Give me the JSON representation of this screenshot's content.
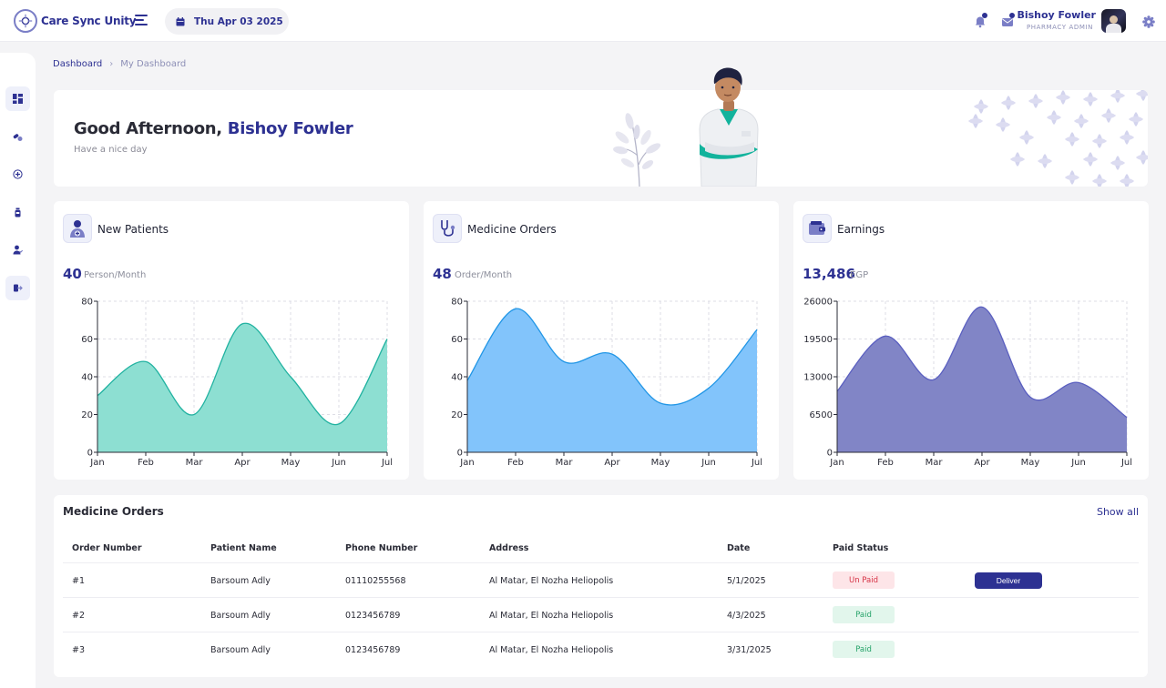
{
  "app": {
    "brand": "Care Sync Unity",
    "date": "Thu Apr 03 2025"
  },
  "user": {
    "name": "Bishoy Fowler",
    "role": "PHARMACY ADMIN"
  },
  "breadcrumb": {
    "home": "Dashboard",
    "separator": "›",
    "current": "My Dashboard"
  },
  "welcome": {
    "greeting": "Good Afternoon,",
    "name": "Bishoy Fowler",
    "subtitle": "Have a nice day"
  },
  "icons": {
    "sidebar": [
      "dashboard-icon",
      "pills-icon",
      "plus-circle-icon",
      "bottle-icon",
      "user-icon",
      "logout-icon"
    ],
    "top": [
      "bell-icon",
      "mail-icon",
      "gear-icon"
    ]
  },
  "colors": {
    "brand": "#2d3192",
    "patients": "#20b2a0",
    "orders": "#2196e6",
    "earnings": "#5a5fc0",
    "unpaid_bg": "#fde5e8",
    "unpaid_text": "#d63345",
    "paid_bg": "#e2f6ec",
    "paid_text": "#27a36a"
  },
  "cards": [
    {
      "title": "New Patients",
      "value": "40",
      "unit": "Person/Month"
    },
    {
      "title": "Medicine Orders",
      "value": "48",
      "unit": "Order/Month"
    },
    {
      "title": "Earnings",
      "value": "13,486",
      "unit": "EGP"
    }
  ],
  "chart_data": [
    {
      "type": "area",
      "categories": [
        "Jan",
        "Feb",
        "Mar",
        "Apr",
        "May",
        "Jun",
        "Jul"
      ],
      "values": [
        30,
        48,
        20,
        68,
        40,
        15,
        60
      ],
      "ylim": [
        0,
        80
      ],
      "yticks": [
        0,
        20,
        40,
        60,
        80
      ],
      "grid": true
    },
    {
      "type": "area",
      "categories": [
        "Jan",
        "Feb",
        "Mar",
        "Apr",
        "May",
        "Jun",
        "Jul"
      ],
      "values": [
        38,
        76,
        48,
        52,
        26,
        34,
        65
      ],
      "ylim": [
        0,
        80
      ],
      "yticks": [
        0,
        20,
        40,
        60,
        80
      ],
      "grid": true
    },
    {
      "type": "area",
      "categories": [
        "Jan",
        "Feb",
        "Mar",
        "Apr",
        "May",
        "Jun",
        "Jul"
      ],
      "values": [
        10500,
        20000,
        12500,
        25000,
        9500,
        12000,
        6000
      ],
      "ylim": [
        0,
        26000
      ],
      "yticks": [
        0,
        6500,
        13000,
        19500,
        26000
      ],
      "grid": true
    }
  ],
  "orders": {
    "title": "Medicine Orders",
    "show_all": "Show all",
    "columns": [
      "Order Number",
      "Patient Name",
      "Phone Number",
      "Address",
      "Date",
      "Paid Status"
    ],
    "rows": [
      {
        "order": "#1",
        "patient": "Barsoum Adly",
        "phone": "01110255568",
        "address": "Al Matar, El Nozha Heliopolis",
        "date": "5/1/2025",
        "status": "Un Paid",
        "paid": false,
        "action": "Deliver"
      },
      {
        "order": "#2",
        "patient": "Barsoum Adly",
        "phone": "0123456789",
        "address": "Al Matar, El Nozha Heliopolis",
        "date": "4/3/2025",
        "status": "Paid",
        "paid": true
      },
      {
        "order": "#3",
        "patient": "Barsoum Adly",
        "phone": "0123456789",
        "address": "Al Matar, El Nozha Heliopolis",
        "date": "3/31/2025",
        "status": "Paid",
        "paid": true
      }
    ]
  }
}
